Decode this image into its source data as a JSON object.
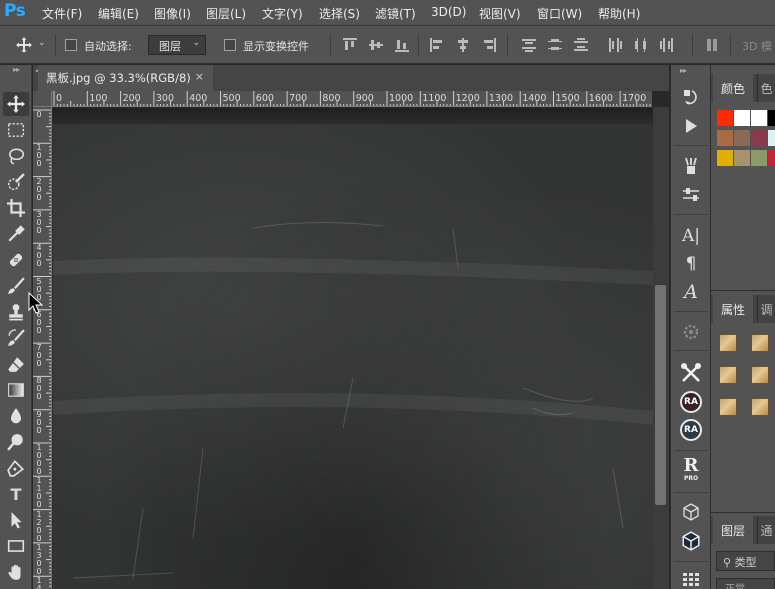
{
  "app": {
    "logo": "Ps"
  },
  "menu": [
    "文件(F)",
    "编辑(E)",
    "图像(I)",
    "图层(L)",
    "文字(Y)",
    "选择(S)",
    "滤镜(T)",
    "3D(D)",
    "视图(V)",
    "窗口(W)",
    "帮助(H)"
  ],
  "options": {
    "move_tool_icon": "move-icon",
    "auto_select_label": "自动选择:",
    "auto_select_checked": false,
    "auto_select_value": "图层",
    "show_transform_label": "显示变换控件",
    "show_transform_checked": false,
    "mode_3d_label": "3D 模"
  },
  "document": {
    "tab_title": "黑板.jpg @ 33.3%(RGB/8)",
    "close_symbol": "×"
  },
  "ruler": {
    "h_zero": "0",
    "h_labels": [
      "0",
      "100",
      "200",
      "300",
      "400",
      "500",
      "600",
      "700",
      "800",
      "900",
      "1000",
      "1100",
      "1200",
      "1300",
      "1400",
      "1500",
      "1600",
      "1700"
    ],
    "v_labels": [
      "0",
      "1\n0\n0",
      "2\n0\n0",
      "3\n0\n0",
      "4\n0\n0",
      "5\n0\n0",
      "6\n0\n0",
      "7\n0\n0",
      "8\n0\n0",
      "9\n0\n0",
      "1\n0\n0\n0",
      "1\n1\n0\n0",
      "1\n2\n0\n0",
      "1\n3\n0\n0",
      "1\n4"
    ]
  },
  "tools": [
    "move-tool",
    "marquee-tool",
    "lasso-tool",
    "quick-select-tool",
    "crop-tool",
    "eyedropper-tool",
    "healing-brush-tool",
    "brush-tool",
    "clone-stamp-tool",
    "history-brush-tool",
    "eraser-tool",
    "gradient-tool",
    "blur-tool",
    "dodge-tool",
    "pen-tool",
    "type-tool",
    "path-select-tool",
    "rectangle-tool",
    "hand-tool"
  ],
  "type_tool_glyph": "T",
  "strip": {
    "ra1": "RA",
    "ra2": "RA",
    "r_pro": "R",
    "r_pro_sub": "PRO",
    "char_glyph": "A|",
    "para_glyph": "¶",
    "glyph_a": "A"
  },
  "panels": {
    "color_tab": "颜色",
    "swatch_tab": "色",
    "properties_tab": "属性",
    "adjust_tab": "调",
    "layers_tab": "图层",
    "channels_tab": "通",
    "search_placeholder": "类型",
    "blend_mode": "正常",
    "swatches": [
      [
        "#ff2a00",
        "#ffffff",
        "#ffffff",
        "#000000"
      ],
      [
        "#a86c45",
        "#8a6a55",
        "#8a3a4a",
        "#d9f2f2"
      ],
      [
        "#e0b000",
        "#a8946a",
        "#8a9a6a",
        "#c0263a"
      ]
    ]
  }
}
